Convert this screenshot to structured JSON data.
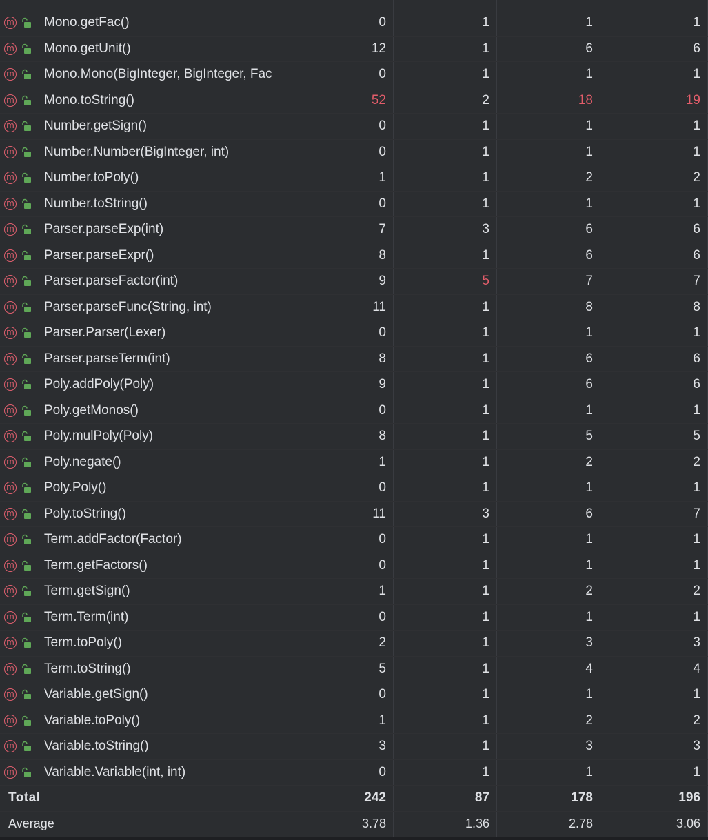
{
  "colors": {
    "background": "#2b2d30",
    "text": "#dfe1e5",
    "highlight": "#e35d6a",
    "method_icon": "#e05f6e",
    "lock_icon": "#5fa757"
  },
  "rows": [
    {
      "name": "Mono.getFac()",
      "v": [
        "0",
        "1",
        "1",
        "1"
      ],
      "red": [
        false,
        false,
        false,
        false
      ]
    },
    {
      "name": "Mono.getUnit()",
      "v": [
        "12",
        "1",
        "6",
        "6"
      ],
      "red": [
        false,
        false,
        false,
        false
      ]
    },
    {
      "name": "Mono.Mono(BigInteger, BigInteger, Fac",
      "v": [
        "0",
        "1",
        "1",
        "1"
      ],
      "red": [
        false,
        false,
        false,
        false
      ]
    },
    {
      "name": "Mono.toString()",
      "v": [
        "52",
        "2",
        "18",
        "19"
      ],
      "red": [
        true,
        false,
        true,
        true
      ]
    },
    {
      "name": "Number.getSign()",
      "v": [
        "0",
        "1",
        "1",
        "1"
      ],
      "red": [
        false,
        false,
        false,
        false
      ]
    },
    {
      "name": "Number.Number(BigInteger, int)",
      "v": [
        "0",
        "1",
        "1",
        "1"
      ],
      "red": [
        false,
        false,
        false,
        false
      ]
    },
    {
      "name": "Number.toPoly()",
      "v": [
        "1",
        "1",
        "2",
        "2"
      ],
      "red": [
        false,
        false,
        false,
        false
      ]
    },
    {
      "name": "Number.toString()",
      "v": [
        "0",
        "1",
        "1",
        "1"
      ],
      "red": [
        false,
        false,
        false,
        false
      ]
    },
    {
      "name": "Parser.parseExp(int)",
      "v": [
        "7",
        "3",
        "6",
        "6"
      ],
      "red": [
        false,
        false,
        false,
        false
      ]
    },
    {
      "name": "Parser.parseExpr()",
      "v": [
        "8",
        "1",
        "6",
        "6"
      ],
      "red": [
        false,
        false,
        false,
        false
      ]
    },
    {
      "name": "Parser.parseFactor(int)",
      "v": [
        "9",
        "5",
        "7",
        "7"
      ],
      "red": [
        false,
        true,
        false,
        false
      ]
    },
    {
      "name": "Parser.parseFunc(String, int)",
      "v": [
        "11",
        "1",
        "8",
        "8"
      ],
      "red": [
        false,
        false,
        false,
        false
      ]
    },
    {
      "name": "Parser.Parser(Lexer)",
      "v": [
        "0",
        "1",
        "1",
        "1"
      ],
      "red": [
        false,
        false,
        false,
        false
      ]
    },
    {
      "name": "Parser.parseTerm(int)",
      "v": [
        "8",
        "1",
        "6",
        "6"
      ],
      "red": [
        false,
        false,
        false,
        false
      ]
    },
    {
      "name": "Poly.addPoly(Poly)",
      "v": [
        "9",
        "1",
        "6",
        "6"
      ],
      "red": [
        false,
        false,
        false,
        false
      ]
    },
    {
      "name": "Poly.getMonos()",
      "v": [
        "0",
        "1",
        "1",
        "1"
      ],
      "red": [
        false,
        false,
        false,
        false
      ]
    },
    {
      "name": "Poly.mulPoly(Poly)",
      "v": [
        "8",
        "1",
        "5",
        "5"
      ],
      "red": [
        false,
        false,
        false,
        false
      ]
    },
    {
      "name": "Poly.negate()",
      "v": [
        "1",
        "1",
        "2",
        "2"
      ],
      "red": [
        false,
        false,
        false,
        false
      ]
    },
    {
      "name": "Poly.Poly()",
      "v": [
        "0",
        "1",
        "1",
        "1"
      ],
      "red": [
        false,
        false,
        false,
        false
      ]
    },
    {
      "name": "Poly.toString()",
      "v": [
        "11",
        "3",
        "6",
        "7"
      ],
      "red": [
        false,
        false,
        false,
        false
      ]
    },
    {
      "name": "Term.addFactor(Factor)",
      "v": [
        "0",
        "1",
        "1",
        "1"
      ],
      "red": [
        false,
        false,
        false,
        false
      ]
    },
    {
      "name": "Term.getFactors()",
      "v": [
        "0",
        "1",
        "1",
        "1"
      ],
      "red": [
        false,
        false,
        false,
        false
      ]
    },
    {
      "name": "Term.getSign()",
      "v": [
        "1",
        "1",
        "2",
        "2"
      ],
      "red": [
        false,
        false,
        false,
        false
      ]
    },
    {
      "name": "Term.Term(int)",
      "v": [
        "0",
        "1",
        "1",
        "1"
      ],
      "red": [
        false,
        false,
        false,
        false
      ]
    },
    {
      "name": "Term.toPoly()",
      "v": [
        "2",
        "1",
        "3",
        "3"
      ],
      "red": [
        false,
        false,
        false,
        false
      ]
    },
    {
      "name": "Term.toString()",
      "v": [
        "5",
        "1",
        "4",
        "4"
      ],
      "red": [
        false,
        false,
        false,
        false
      ]
    },
    {
      "name": "Variable.getSign()",
      "v": [
        "0",
        "1",
        "1",
        "1"
      ],
      "red": [
        false,
        false,
        false,
        false
      ]
    },
    {
      "name": "Variable.toPoly()",
      "v": [
        "1",
        "1",
        "2",
        "2"
      ],
      "red": [
        false,
        false,
        false,
        false
      ]
    },
    {
      "name": "Variable.toString()",
      "v": [
        "3",
        "1",
        "3",
        "3"
      ],
      "red": [
        false,
        false,
        false,
        false
      ]
    },
    {
      "name": "Variable.Variable(int, int)",
      "v": [
        "0",
        "1",
        "1",
        "1"
      ],
      "red": [
        false,
        false,
        false,
        false
      ]
    }
  ],
  "method_icon_glyph": "m",
  "total": {
    "label": "Total",
    "v": [
      "242",
      "87",
      "178",
      "196"
    ]
  },
  "average": {
    "label": "Average",
    "v": [
      "3.78",
      "1.36",
      "2.78",
      "3.06"
    ]
  }
}
